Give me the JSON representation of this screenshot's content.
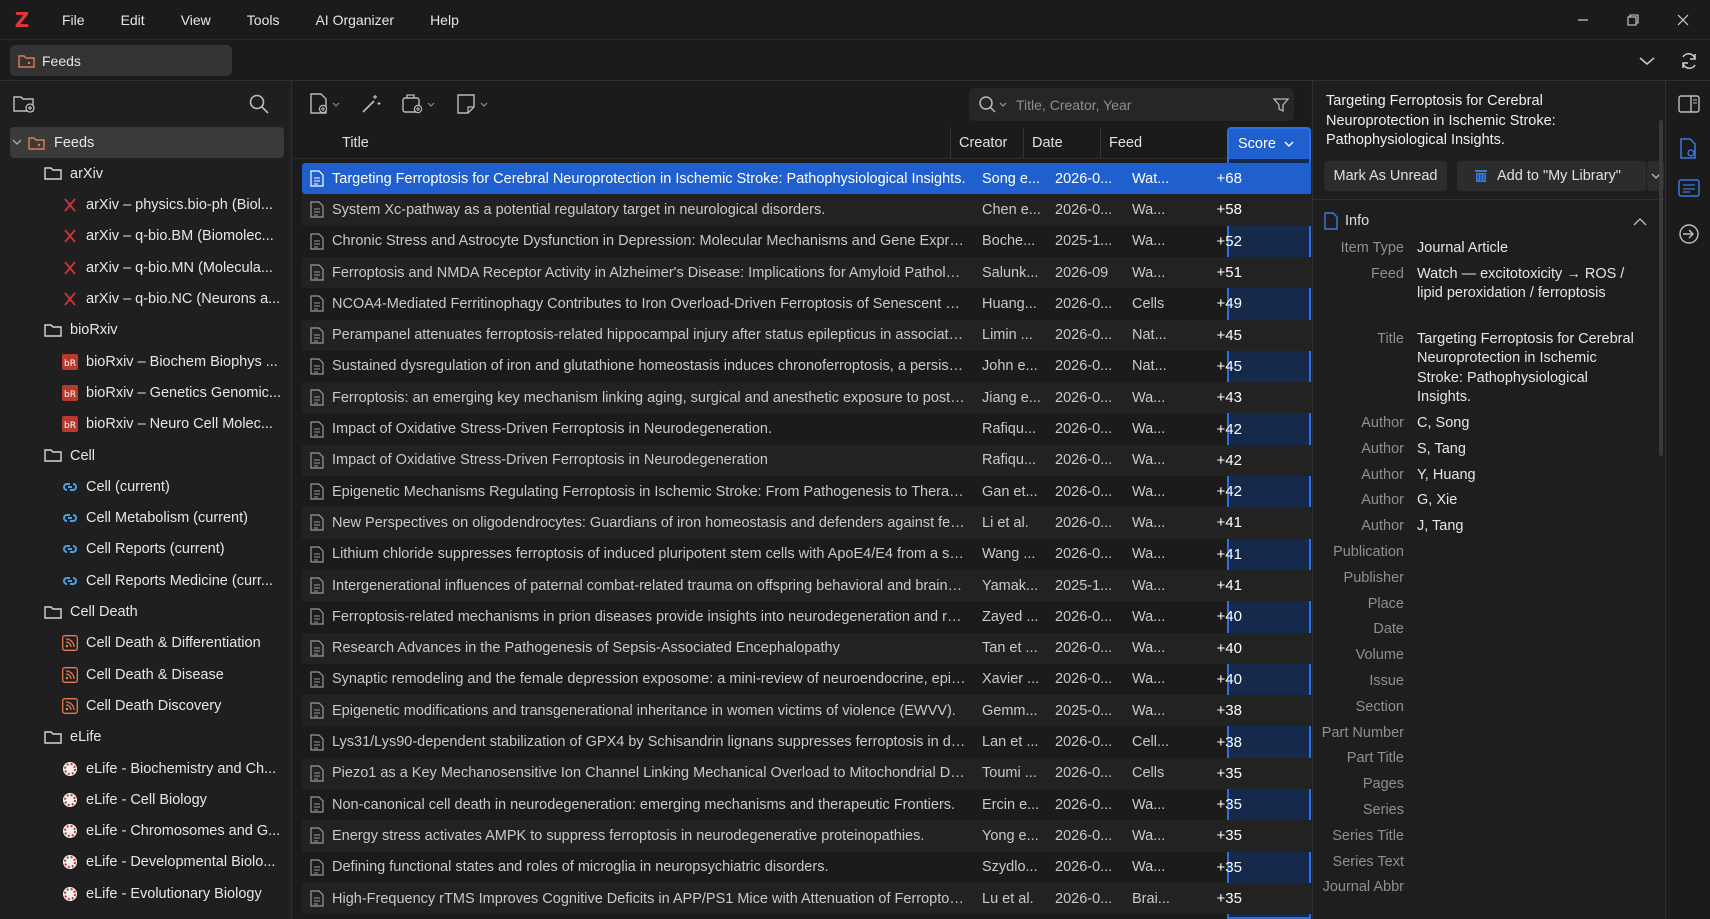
{
  "app": {
    "logo": "Z",
    "menu": [
      "File",
      "Edit",
      "View",
      "Tools",
      "AI Organizer",
      "Help"
    ]
  },
  "tab": {
    "label": "Feeds"
  },
  "search": {
    "placeholder": "Title, Creator, Year"
  },
  "tree": [
    {
      "label": "Feeds",
      "level": 0,
      "icon": "feeds-icon",
      "expanded": true,
      "selected": true
    },
    {
      "label": "arXiv",
      "level": 1,
      "icon": "folder-icon"
    },
    {
      "label": "arXiv – physics.bio-ph (Biol...",
      "level": 2,
      "icon": "arxiv-icon"
    },
    {
      "label": "arXiv – q-bio.BM (Biomolec...",
      "level": 2,
      "icon": "arxiv-icon"
    },
    {
      "label": "arXiv – q-bio.MN (Molecula...",
      "level": 2,
      "icon": "arxiv-icon"
    },
    {
      "label": "arXiv – q-bio.NC (Neurons a...",
      "level": 2,
      "icon": "arxiv-icon"
    },
    {
      "label": "bioRxiv",
      "level": 1,
      "icon": "folder-icon"
    },
    {
      "label": "bioRxiv – Biochem Biophys ...",
      "level": 2,
      "icon": "biorxiv-icon"
    },
    {
      "label": "bioRxiv – Genetics Genomic...",
      "level": 2,
      "icon": "biorxiv-icon"
    },
    {
      "label": "bioRxiv – Neuro Cell Molec...",
      "level": 2,
      "icon": "biorxiv-icon"
    },
    {
      "label": "Cell",
      "level": 1,
      "icon": "folder-icon"
    },
    {
      "label": "Cell (current)",
      "level": 2,
      "icon": "cell-icon"
    },
    {
      "label": "Cell Metabolism (current)",
      "level": 2,
      "icon": "cell-icon"
    },
    {
      "label": "Cell Reports (current)",
      "level": 2,
      "icon": "cell-icon"
    },
    {
      "label": "Cell Reports Medicine (curr...",
      "level": 2,
      "icon": "cell-icon"
    },
    {
      "label": "Cell Death",
      "level": 1,
      "icon": "folder-icon"
    },
    {
      "label": "Cell Death & Differentiation",
      "level": 2,
      "icon": "rss-icon"
    },
    {
      "label": "Cell Death & Disease",
      "level": 2,
      "icon": "rss-icon"
    },
    {
      "label": "Cell Death Discovery",
      "level": 2,
      "icon": "rss-icon"
    },
    {
      "label": "eLife",
      "level": 1,
      "icon": "folder-icon"
    },
    {
      "label": "eLife - Biochemistry and Ch...",
      "level": 2,
      "icon": "elife-icon"
    },
    {
      "label": "eLife - Cell Biology",
      "level": 2,
      "icon": "elife-icon"
    },
    {
      "label": "eLife - Chromosomes and G...",
      "level": 2,
      "icon": "elife-icon"
    },
    {
      "label": "eLife - Developmental Biolo...",
      "level": 2,
      "icon": "elife-icon"
    },
    {
      "label": "eLife - Evolutionary Biology",
      "level": 2,
      "icon": "elife-icon"
    }
  ],
  "columns": {
    "title": "Title",
    "creator": "Creator",
    "date": "Date",
    "feed": "Feed",
    "score": "Score"
  },
  "items": [
    {
      "title": "Targeting Ferroptosis for Cerebral Neuroprotection in Ischemic Stroke: Pathophysiological Insights.",
      "creator": "Song e...",
      "date": "2026-0...",
      "feed": "Wat...",
      "score": "+68",
      "selected": true
    },
    {
      "title": "System Xc-pathway as a potential regulatory target in neurological disorders.",
      "creator": "Chen e...",
      "date": "2026-0...",
      "feed": "Wa...",
      "score": "+58"
    },
    {
      "title": "Chronic Stress and Astrocyte Dysfunction in Depression: Molecular Mechanisms and Gene Expression C...",
      "creator": "Boche...",
      "date": "2025-1...",
      "feed": "Wa...",
      "score": "+52"
    },
    {
      "title": "Ferroptosis and NMDA Receptor Activity in Alzheimer's Disease: Implications for Amyloid Pathology an...",
      "creator": "Salunk...",
      "date": "2026-09",
      "feed": "Wa...",
      "score": "+51"
    },
    {
      "title": "NCOA4-Mediated Ferritinophagy Contributes to Iron Overload-Driven Ferroptosis of Senescent Myobla...",
      "creator": "Huang...",
      "date": "2026-0...",
      "feed": "Cells",
      "score": "+49"
    },
    {
      "title": "Perampanel attenuates ferroptosis-related hippocampal injury after status epilepticus in association wit...",
      "creator": "Limin ...",
      "date": "2026-0...",
      "feed": "Nat...",
      "score": "+45"
    },
    {
      "title": "Sustained dysregulation of iron and glutathione homeostasis induces chronoferroptosis, a persistent fe...",
      "creator": "John e...",
      "date": "2026-0...",
      "feed": "Nat...",
      "score": "+45"
    },
    {
      "title": "Ferroptosis: an emerging key mechanism linking aging, surgical and anesthetic exposure to postoperati...",
      "creator": "Jiang e...",
      "date": "2026-0...",
      "feed": "Wa...",
      "score": "+43"
    },
    {
      "title": "Impact of Oxidative Stress-Driven Ferroptosis in Neurodegeneration.",
      "creator": "Rafiqu...",
      "date": "2026-0...",
      "feed": "Wa...",
      "score": "+42"
    },
    {
      "title": "Impact of Oxidative Stress-Driven Ferroptosis in Neurodegeneration",
      "creator": "Rafiqu...",
      "date": "2026-0...",
      "feed": "Wa...",
      "score": "+42"
    },
    {
      "title": "Epigenetic Mechanisms Regulating Ferroptosis in Ischemic Stroke: From Pathogenesis to Therapeutic Ta...",
      "creator": "Gan et...",
      "date": "2026-0...",
      "feed": "Wa...",
      "score": "+42"
    },
    {
      "title": "New Perspectives on oligodendrocytes: Guardians of iron homeostasis and defenders against ferroptosis.",
      "creator": "Li et al.",
      "date": "2026-0...",
      "feed": "Wa...",
      "score": "+41"
    },
    {
      "title": "Lithium chloride suppresses ferroptosis of induced pluripotent stem cells with ApoE4/E4 from a sporadi...",
      "creator": "Wang ...",
      "date": "2026-0...",
      "feed": "Wa...",
      "score": "+41"
    },
    {
      "title": "Intergenerational influences of paternal combat-related trauma on offspring behavioral and brain funct...",
      "creator": "Yamak...",
      "date": "2025-1...",
      "feed": "Wa...",
      "score": "+41"
    },
    {
      "title": "Ferroptosis-related mechanisms in prion diseases provide insights into neurodegeneration and reveal t...",
      "creator": "Zayed ...",
      "date": "2026-0...",
      "feed": "Wa...",
      "score": "+40"
    },
    {
      "title": "Research Advances in the Pathogenesis of Sepsis-Associated Encephalopathy",
      "creator": "Tan et ...",
      "date": "2026-0...",
      "feed": "Wa...",
      "score": "+40"
    },
    {
      "title": "Synaptic remodeling and the female depression exposome: a mini-review of neuroendocrine, epigeneti...",
      "creator": "Xavier ...",
      "date": "2026-0...",
      "feed": "Wa...",
      "score": "+40"
    },
    {
      "title": "Epigenetic modifications and transgenerational inheritance in women victims of violence (EWVV).",
      "creator": "Gemm...",
      "date": "2025-0...",
      "feed": "Wa...",
      "score": "+38"
    },
    {
      "title": "Lys31/Lys90-dependent stabilization of GPX4 by Schisandrin lignans suppresses ferroptosis in drug-ind...",
      "creator": "Lan et ...",
      "date": "2026-0...",
      "feed": "Cell...",
      "score": "+38"
    },
    {
      "title": "Piezo1 as a Key Mechanosensitive Ion Channel Linking Mechanical Overload to Mitochondrial Dysfuncti...",
      "creator": "Toumi ...",
      "date": "2026-0...",
      "feed": "Cells",
      "score": "+35"
    },
    {
      "title": "Non-canonical cell death in neurodegeneration: emerging mechanisms and therapeutic Frontiers.",
      "creator": "Ercin e...",
      "date": "2026-0...",
      "feed": "Wa...",
      "score": "+35"
    },
    {
      "title": "Energy stress activates AMPK to suppress ferroptosis in neurodegenerative proteinopathies.",
      "creator": "Yong e...",
      "date": "2026-0...",
      "feed": "Wa...",
      "score": "+35"
    },
    {
      "title": "Defining functional states and roles of microglia in neuropsychiatric disorders.",
      "creator": "Szydlo...",
      "date": "2026-0...",
      "feed": "Wa...",
      "score": "+35"
    },
    {
      "title": "High-Frequency rTMS Improves Cognitive Deficits in APP/PS1 Mice with Attenuation of Ferroptosis-Rel...",
      "creator": "Lu et al.",
      "date": "2026-0...",
      "feed": "Brai...",
      "score": "+35"
    }
  ],
  "detail": {
    "title": "Targeting Ferroptosis for Cerebral Neuroprotection in Ischemic Stroke: Pathophysiological Insights.",
    "mark_unread": "Mark As Unread",
    "add_to_library": "Add to \"My Library\"",
    "info_header": "Info",
    "fields": [
      {
        "label": "Item Type",
        "value": "Journal Article"
      },
      {
        "label": "Feed",
        "value": "Watch — excitotoxicity → ROS / lipid peroxidation / ferroptosis"
      },
      {
        "label": "Title",
        "value": "Targeting Ferroptosis for Cerebral Neuroprotection in Ischemic Stroke: Pathophysiological Insights."
      },
      {
        "label": "Author",
        "value": "C, Song"
      },
      {
        "label": "Author",
        "value": "S, Tang"
      },
      {
        "label": "Author",
        "value": "Y, Huang"
      },
      {
        "label": "Author",
        "value": "G, Xie"
      },
      {
        "label": "Author",
        "value": "J, Tang"
      },
      {
        "label": "Publication",
        "value": ""
      },
      {
        "label": "Publisher",
        "value": ""
      },
      {
        "label": "Place",
        "value": ""
      },
      {
        "label": "Date",
        "value": ""
      },
      {
        "label": "Volume",
        "value": ""
      },
      {
        "label": "Issue",
        "value": ""
      },
      {
        "label": "Section",
        "value": ""
      },
      {
        "label": "Part Number",
        "value": ""
      },
      {
        "label": "Part Title",
        "value": ""
      },
      {
        "label": "Pages",
        "value": ""
      },
      {
        "label": "Series",
        "value": ""
      },
      {
        "label": "Series Title",
        "value": ""
      },
      {
        "label": "Series Text",
        "value": ""
      },
      {
        "label": "Journal Abbr",
        "value": ""
      }
    ]
  },
  "colors": {
    "selection": "#1f5fce",
    "score_border": "#2d6fe0",
    "logo": "#e0353b"
  }
}
